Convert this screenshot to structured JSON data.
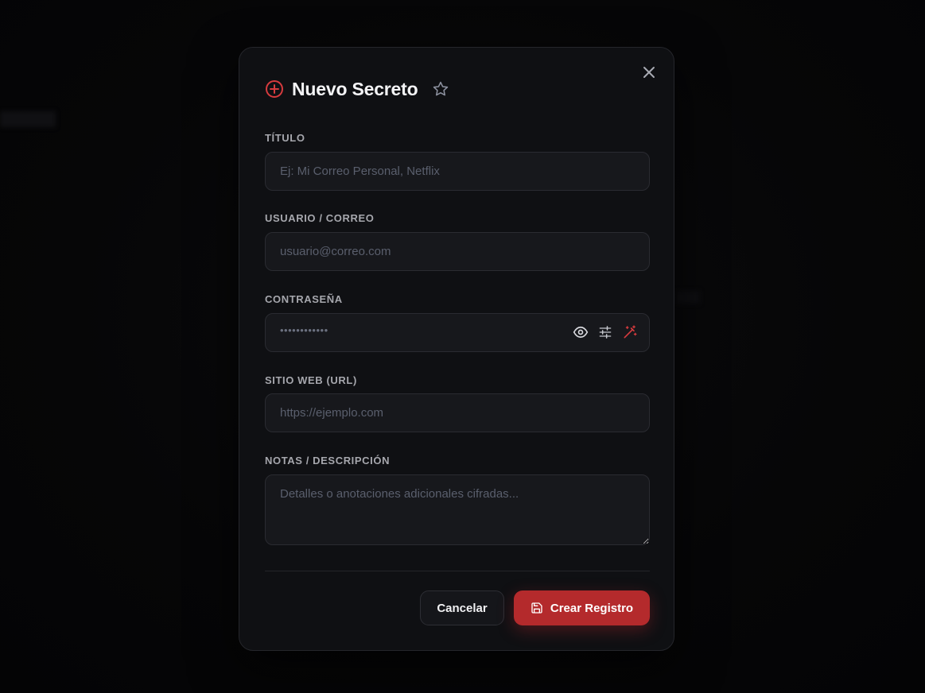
{
  "modal": {
    "title": "Nuevo Secreto",
    "accent_color": "#d63b3e",
    "fields": {
      "title": {
        "label": "TÍTULO",
        "value": "",
        "placeholder": "Ej: Mi Correo Personal, Netflix"
      },
      "username": {
        "label": "USUARIO / CORREO",
        "value": "",
        "placeholder": "usuario@correo.com"
      },
      "password": {
        "label": "CONTRASEÑA",
        "masked_value": "••••••••••••"
      },
      "url": {
        "label": "SITIO WEB (URL)",
        "value": "",
        "placeholder": "https://ejemplo.com"
      },
      "notes": {
        "label": "NOTAS / DESCRIPCIÓN",
        "value": "",
        "placeholder": "Detalles o anotaciones adicionales cifradas..."
      }
    },
    "icons": {
      "header": "plus-circle-icon",
      "favorite": "star-icon",
      "close": "close-icon",
      "toggle_visibility": "eye-icon",
      "generator_options": "sliders-icon",
      "generate": "magic-wand-icon",
      "save": "save-icon"
    },
    "buttons": {
      "cancel": "Cancelar",
      "create": "Crear Registro"
    }
  }
}
